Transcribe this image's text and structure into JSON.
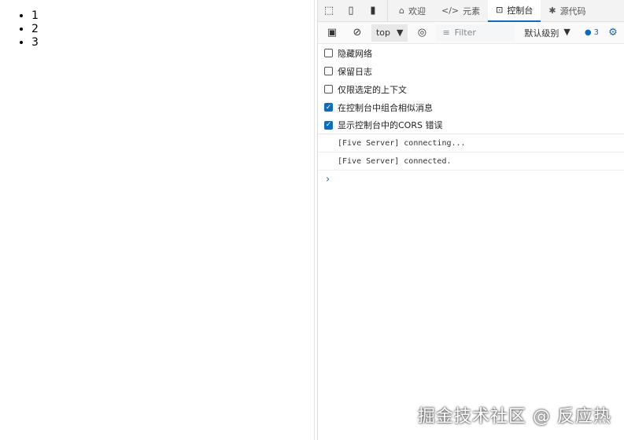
{
  "page": {
    "list": [
      "1",
      "2",
      "3"
    ]
  },
  "devtools": {
    "tabs": [
      {
        "label": "欢迎",
        "icon": "home-icon"
      },
      {
        "label": "元素",
        "icon": "code-icon"
      },
      {
        "label": "控制台",
        "icon": "console-icon"
      },
      {
        "label": "源代码",
        "icon": "bug-icon"
      }
    ],
    "toolbar": {
      "context": "top",
      "filter_placeholder": "Filter",
      "level": "默认级别",
      "message_count": "3"
    },
    "options": [
      {
        "label": "隐藏网络",
        "checked": false
      },
      {
        "label": "保留日志",
        "checked": false
      },
      {
        "label": "仅限选定的上下文",
        "checked": false
      },
      {
        "label": "在控制台中组合相似消息",
        "checked": true
      },
      {
        "label": "显示控制台中的CORS 错误",
        "checked": true
      }
    ],
    "logs": [
      "[Five Server] connecting...",
      "[Five Server] connected."
    ],
    "prompt": "›"
  },
  "watermark": "掘金技术社区 @ 反应热",
  "colors": {
    "accent": "#0f6cbd"
  }
}
